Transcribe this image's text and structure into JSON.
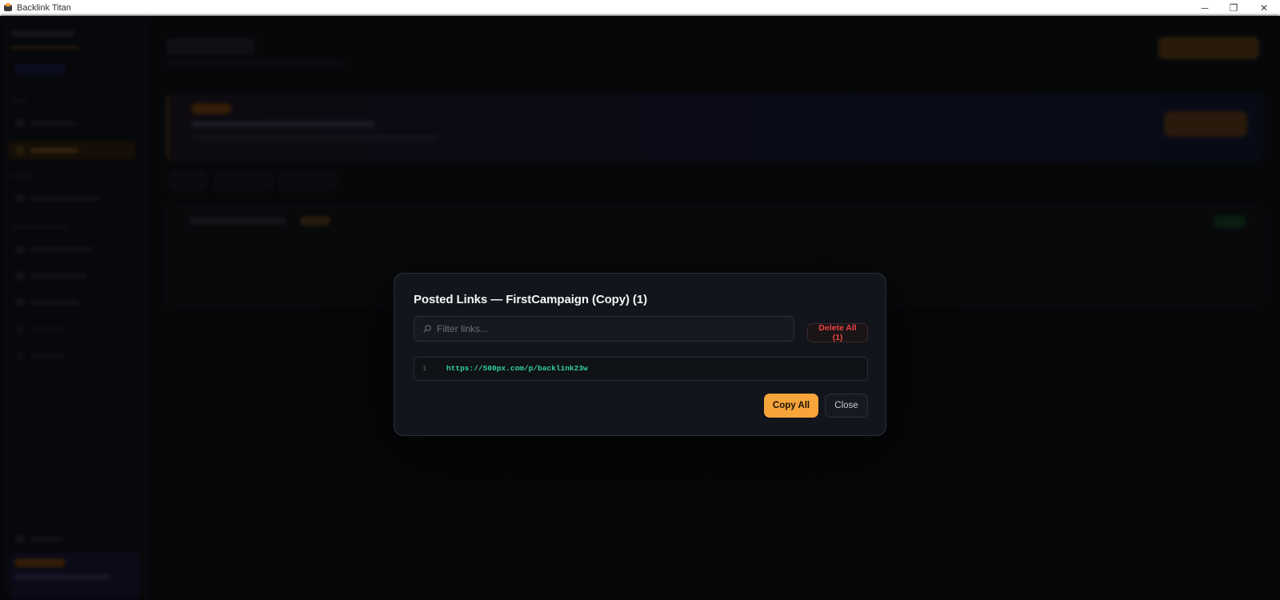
{
  "window": {
    "title": "Backlink Titan",
    "minimize_glyph": "─",
    "restore_glyph": "❐",
    "close_glyph": "✕"
  },
  "modal": {
    "title": "Posted Links — FirstCampaign (Copy) (1)",
    "search_placeholder": "Filter links...",
    "search_value": "",
    "delete_all_label": "Delete All (1)",
    "links": [
      {
        "index": "1",
        "url": "https://500px.com/p/backlink23w"
      }
    ],
    "copy_all_label": "Copy All",
    "close_label": "Close"
  },
  "colors": {
    "accent": "#f7a43b",
    "danger": "#ef4444",
    "link": "#34d399",
    "modal_bg": "#12151b"
  }
}
